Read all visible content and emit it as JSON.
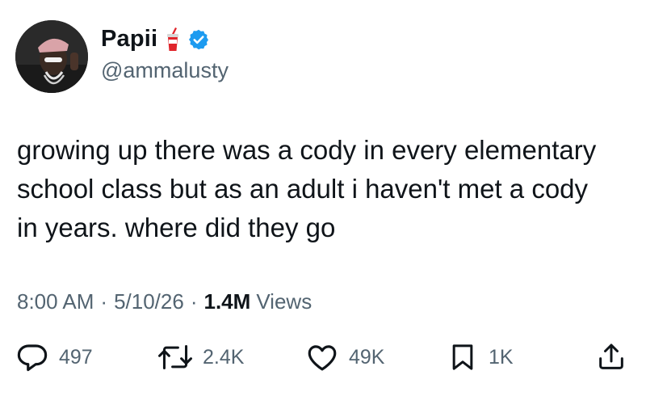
{
  "author": {
    "display_name": "Papii",
    "name_emoji": "cup-with-straw-icon",
    "verified_badge": "verified-badge-icon",
    "verified_color": "#1d9bf0",
    "handle": "@ammalusty"
  },
  "tweet": {
    "text": "growing up there was a cody in every elementary\nschool class but as an adult i haven't met a cody\nin years. where did they go"
  },
  "meta": {
    "time": "8:00 AM",
    "separator": "·",
    "date": "5/10/26",
    "views_count": "1.4M",
    "views_label": "Views"
  },
  "actions": {
    "reply": {
      "icon": "reply-icon",
      "count": "497"
    },
    "retweet": {
      "icon": "retweet-icon",
      "count": "2.4K"
    },
    "like": {
      "icon": "heart-icon",
      "count": "49K"
    },
    "bookmark": {
      "icon": "bookmark-icon",
      "count": "1K"
    },
    "share": {
      "icon": "share-icon"
    }
  }
}
